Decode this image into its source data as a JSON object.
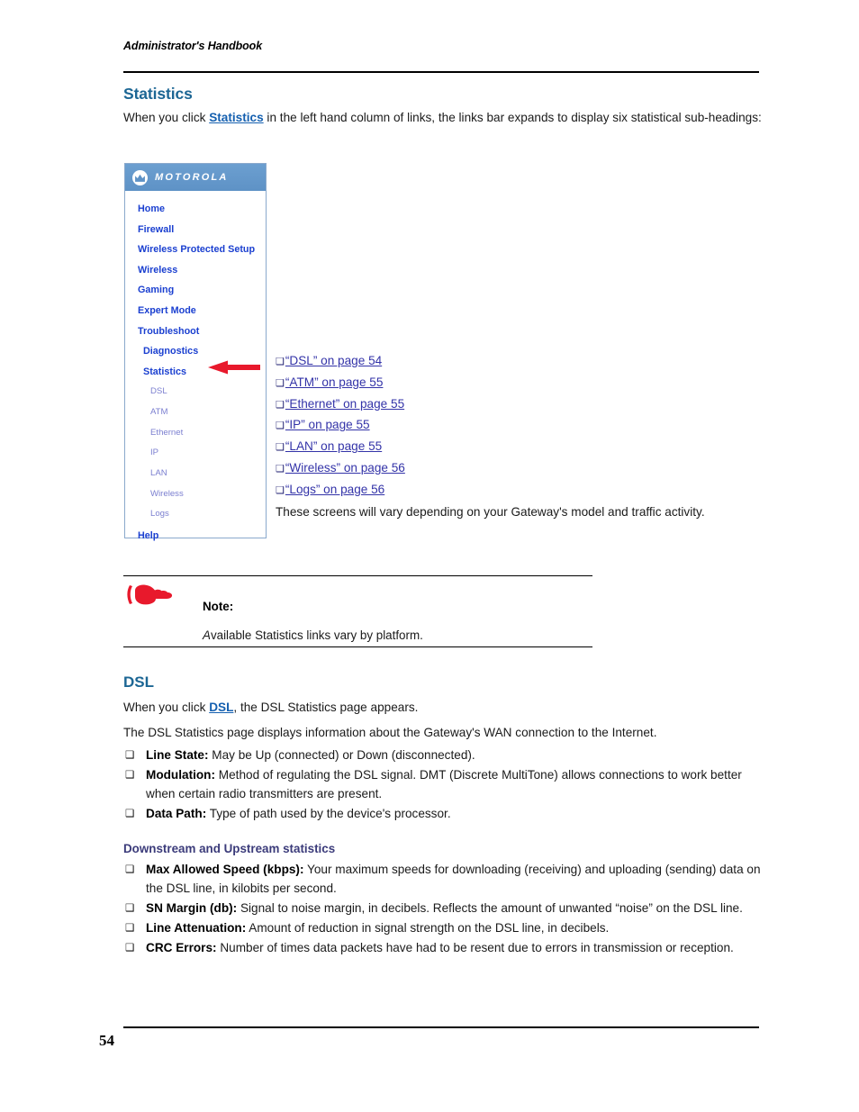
{
  "page": {
    "running_head": "Administrator's Handbook",
    "folio": "54"
  },
  "section": {
    "heading": "Statistics",
    "intro_before": "When you click ",
    "intro_link": "Statistics",
    "intro_after": " in the left hand column of links, the links bar expands to display six statistical sub-headings:",
    "vary_note": "These screens will vary depending on your Gateway's model and traffic activity."
  },
  "nav_panel": {
    "brand": "MOTOROLA",
    "brand_icon": "motorola-m-logo",
    "items": [
      {
        "label": "Home",
        "level": 1
      },
      {
        "label": "Firewall",
        "level": 1
      },
      {
        "label": "Wireless Protected Setup",
        "level": 1
      },
      {
        "label": "Wireless",
        "level": 1
      },
      {
        "label": "Gaming",
        "level": 1
      },
      {
        "label": "Expert Mode",
        "level": 1
      },
      {
        "label": "Troubleshoot",
        "level": 1
      },
      {
        "label": "Diagnostics",
        "level": 2
      },
      {
        "label": "Statistics",
        "level": 2
      },
      {
        "label": "DSL",
        "level": 3
      },
      {
        "label": "ATM",
        "level": 3
      },
      {
        "label": "Ethernet",
        "level": 3
      },
      {
        "label": "IP",
        "level": 3
      },
      {
        "label": "LAN",
        "level": 3
      },
      {
        "label": "Wireless",
        "level": 3
      },
      {
        "label": "Logs",
        "level": 3
      },
      {
        "label": "Help",
        "level": 1
      }
    ],
    "callout_arrow": "red-left-arrow",
    "arrow_target": "Statistics"
  },
  "xref_links": [
    {
      "glyph": "❑",
      "text": "“DSL” on page 54"
    },
    {
      "glyph": "❑",
      "text": "“ATM” on page 55"
    },
    {
      "glyph": "❑",
      "text": "“Ethernet” on page 55"
    },
    {
      "glyph": "❑",
      "text": "“IP” on page 55"
    },
    {
      "glyph": "❑",
      "text": "“LAN” on page 55"
    },
    {
      "glyph": "❑",
      "text": "“Wireless” on page 56"
    },
    {
      "glyph": "❑",
      "text": "“Logs” on page 56"
    }
  ],
  "note": {
    "icon": "pointing-hand-icon",
    "label": "Note:",
    "first_letter": "A",
    "rest": "vailable Statistics links vary by platform."
  },
  "dsl": {
    "heading": "DSL",
    "p1_before": "When you click ",
    "p1_link": "DSL",
    "p1_after": ", the DSL Statistics page appears.",
    "p2": "The DSL Statistics page displays information about the Gateway's WAN connection to the Internet.",
    "bullets": [
      {
        "glyph": "❑",
        "term": "Line State:",
        "desc": " May be Up (connected) or Down (disconnected)."
      },
      {
        "glyph": "❑",
        "term": "Modulation:",
        "desc": " Method of regulating the DSL signal. DMT (Discrete MultiTone) allows connections to work better when certain radio transmitters are present."
      },
      {
        "glyph": "❑",
        "term": "Data Path:",
        "desc": " Type of path used by the device's processor."
      }
    ]
  },
  "downstream": {
    "heading": "Downstream and Upstream statistics",
    "bullets": [
      {
        "glyph": "❑",
        "term": "Max Allowed Speed (kbps):",
        "desc": " Your maximum speeds for downloading (receiving) and uploading (sending) data on the DSL line, in kilobits per second."
      },
      {
        "glyph": "❑",
        "term": "SN Margin (db):",
        "desc": " Signal to noise margin, in decibels. Reflects the amount of unwanted “noise” on the DSL line."
      },
      {
        "glyph": "❑",
        "term": "Line Attenuation:",
        "desc": " Amount of reduction in signal strength on the DSL line, in decibels."
      },
      {
        "glyph": "❑",
        "term": "CRC Errors:",
        "desc": " Number of times data packets have had to be resent due to errors in transmission or reception."
      }
    ]
  },
  "colors": {
    "heading_teal": "#1c6694",
    "link_blue": "#1560b0",
    "xref_blue": "#3333a8",
    "nav_blue": "#1a3fd0",
    "nav_sub_purple": "#7b7fd0",
    "nav_header_blue": "#6699cc",
    "accent_red": "#e8192c",
    "subhead_purple": "#3b3b7a"
  }
}
